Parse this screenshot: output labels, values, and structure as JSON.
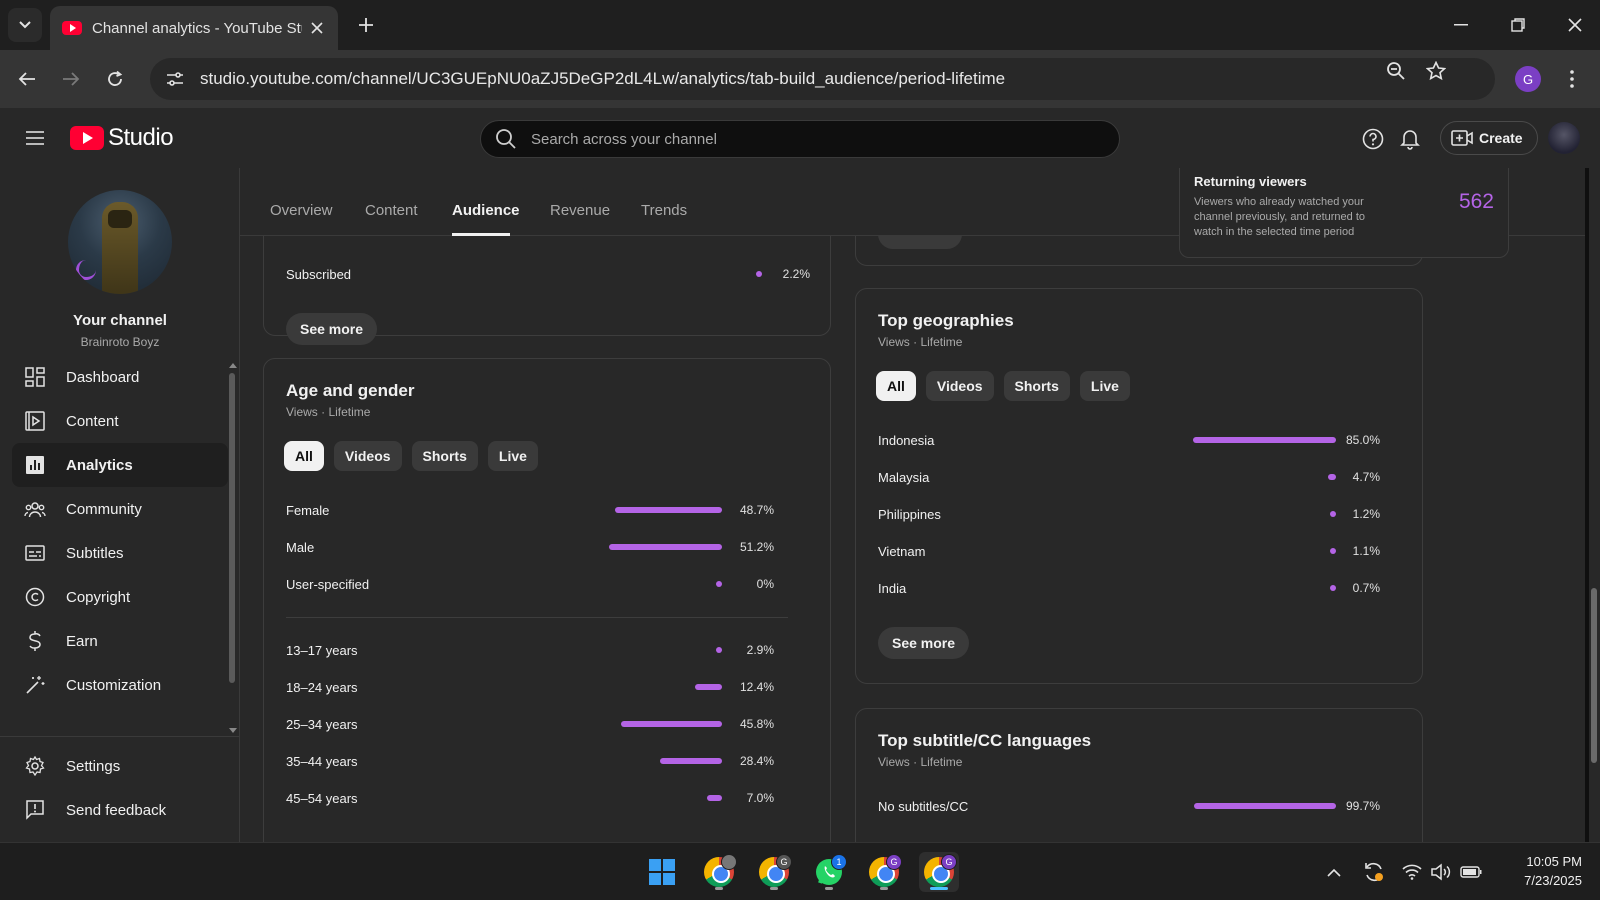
{
  "browser": {
    "tab_title": "Channel analytics - YouTube Studio",
    "url": "studio.youtube.com/channel/UC3GUEpNU0aZJ5DeGP2dL4Lw/analytics/tab-build_audience/period-lifetime",
    "profile_initial": "G"
  },
  "header": {
    "logo_text": "Studio",
    "search_placeholder": "Search across your channel",
    "create_label": "Create"
  },
  "sidebar": {
    "channel_title": "Your channel",
    "channel_name": "Brainroto Boyz",
    "items": [
      {
        "label": "Dashboard",
        "icon": "dashboard-icon"
      },
      {
        "label": "Content",
        "icon": "content-icon"
      },
      {
        "label": "Analytics",
        "icon": "analytics-icon",
        "active": true
      },
      {
        "label": "Community",
        "icon": "community-icon"
      },
      {
        "label": "Subtitles",
        "icon": "subtitles-icon"
      },
      {
        "label": "Copyright",
        "icon": "copyright-icon"
      },
      {
        "label": "Earn",
        "icon": "earn-icon"
      },
      {
        "label": "Customization",
        "icon": "customization-icon"
      }
    ],
    "bottom_items": [
      {
        "label": "Settings",
        "icon": "settings-icon"
      },
      {
        "label": "Send feedback",
        "icon": "feedback-icon"
      }
    ]
  },
  "analytics_tabs": [
    "Overview",
    "Content",
    "Audience",
    "Revenue",
    "Trends"
  ],
  "active_tab": "Audience",
  "subscription_card": {
    "row_label": "Subscribed",
    "row_value": "2.2%",
    "row_fraction": 0.022,
    "see_more": "See more"
  },
  "returning_viewers": {
    "title": "Returning viewers",
    "description": "Viewers who already watched your channel previously, and returned to watch in the selected time period",
    "value": "562"
  },
  "age_gender": {
    "title": "Age and gender",
    "subtitle": "Views · Lifetime",
    "chips": [
      "All",
      "Videos",
      "Shorts",
      "Live"
    ],
    "gender": [
      {
        "label": "Female",
        "value": "48.7%",
        "fraction": 0.487
      },
      {
        "label": "Male",
        "value": "51.2%",
        "fraction": 0.512
      },
      {
        "label": "User-specified",
        "value": "0%",
        "fraction": 0.0
      }
    ],
    "ages": [
      {
        "label": "13–17 years",
        "value": "2.9%",
        "fraction": 0.029
      },
      {
        "label": "18–24 years",
        "value": "12.4%",
        "fraction": 0.124
      },
      {
        "label": "25–34 years",
        "value": "45.8%",
        "fraction": 0.458
      },
      {
        "label": "35–44 years",
        "value": "28.4%",
        "fraction": 0.284
      },
      {
        "label": "45–54 years",
        "value": "7.0%",
        "fraction": 0.07
      }
    ]
  },
  "geographies": {
    "title": "Top geographies",
    "subtitle": "Views · Lifetime",
    "chips": [
      "All",
      "Videos",
      "Shorts",
      "Live"
    ],
    "rows": [
      {
        "label": "Indonesia",
        "value": "85.0%",
        "fraction": 0.85
      },
      {
        "label": "Malaysia",
        "value": "4.7%",
        "fraction": 0.047
      },
      {
        "label": "Philippines",
        "value": "1.2%",
        "fraction": 0.012
      },
      {
        "label": "Vietnam",
        "value": "1.1%",
        "fraction": 0.011
      },
      {
        "label": "India",
        "value": "0.7%",
        "fraction": 0.007
      }
    ],
    "see_more": "See more"
  },
  "subtitle_languages": {
    "title": "Top subtitle/CC languages",
    "subtitle": "Views · Lifetime",
    "rows": [
      {
        "label": "No subtitles/CC",
        "value": "99.7%",
        "fraction": 0.997
      }
    ]
  },
  "taskbar": {
    "time": "10:05 PM",
    "date": "7/23/2025",
    "whatsapp_badge": "1",
    "chrome_badge": "G"
  },
  "colors": {
    "accent_purple": "#b464e6",
    "youtube_red": "#ff0033"
  }
}
